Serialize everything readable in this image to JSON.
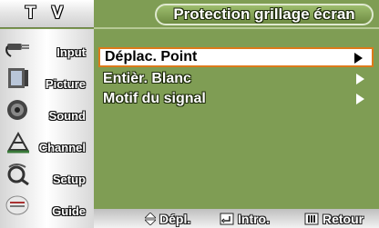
{
  "header": {
    "tv_label": "T V",
    "title": "Protection grillage écran"
  },
  "sidebar": {
    "items": [
      {
        "label": "Input",
        "icon": "input-plug-icon"
      },
      {
        "label": "Picture",
        "icon": "picture-icon"
      },
      {
        "label": "Sound",
        "icon": "speaker-icon"
      },
      {
        "label": "Channel",
        "icon": "antenna-icon"
      },
      {
        "label": "Setup",
        "icon": "setup-icon"
      },
      {
        "label": "Guide",
        "icon": "guide-icon"
      }
    ]
  },
  "menu": {
    "items": [
      {
        "label": "Déplac. Point",
        "selected": true
      },
      {
        "label": "Entièr. Blanc",
        "selected": false
      },
      {
        "label": "Motif du signal",
        "selected": false
      }
    ]
  },
  "footer": {
    "move_label": "Dépl.",
    "enter_label": "Intro.",
    "return_label": "Retour"
  },
  "colors": {
    "background": "#7f9d54",
    "selection_border": "#dd7a1a",
    "selection_fill": "#ffffff"
  }
}
